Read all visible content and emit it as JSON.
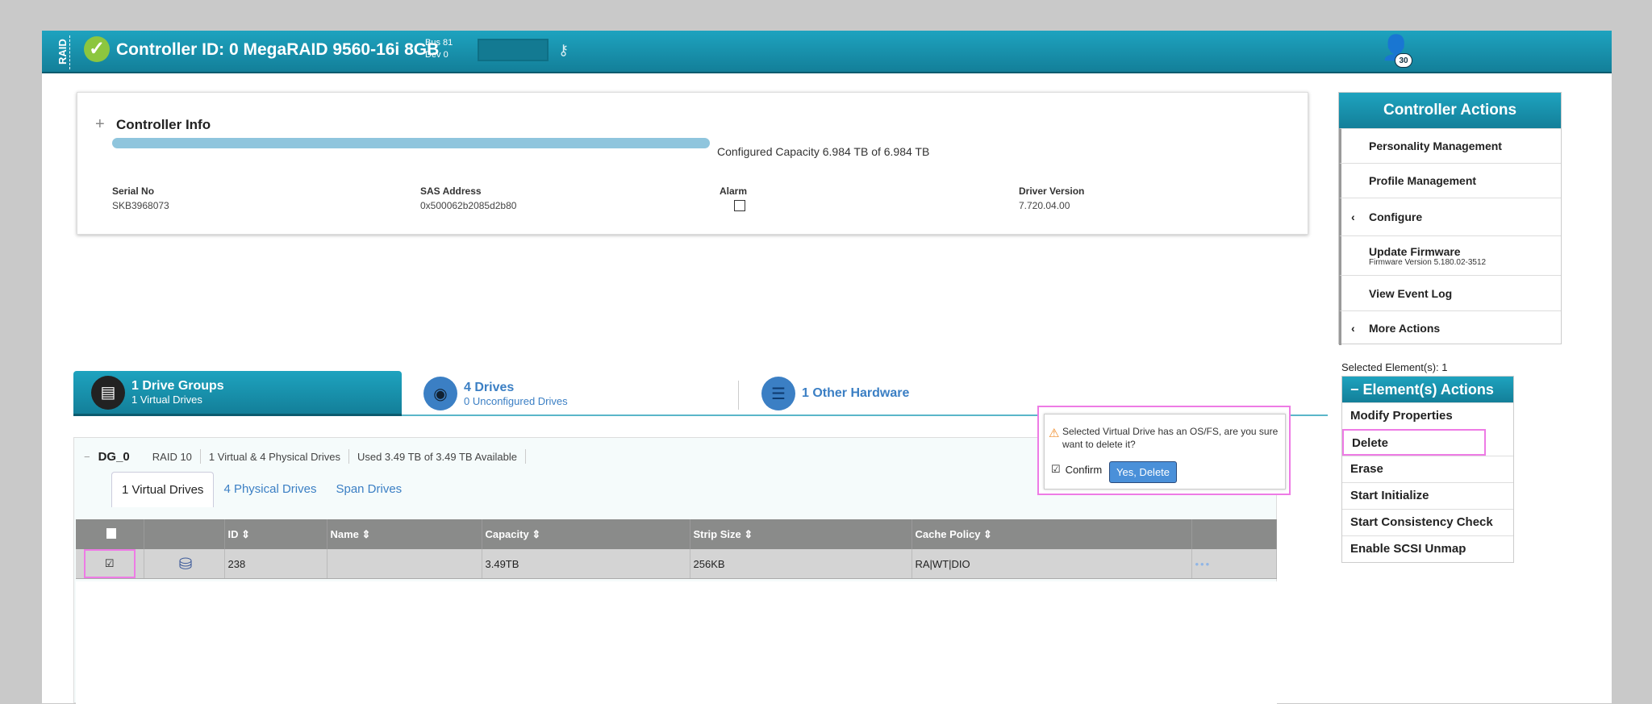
{
  "header": {
    "side_label": "RAID",
    "title": "Controller ID: 0 MegaRAID 9560-16i 8GB",
    "bus": "Bus 81",
    "dev": "Dev 0",
    "user_badge": "30"
  },
  "controller_info": {
    "title": "Controller Info",
    "configured_capacity": "Configured Capacity 6.984 TB of 6.984 TB",
    "capacity_fraction": 1.0,
    "fields": [
      {
        "label": "Serial No",
        "value": "SKB3968073"
      },
      {
        "label": "SAS Address",
        "value": "0x500062b2085d2b80"
      },
      {
        "label": "Alarm",
        "checked": false
      },
      {
        "label": "Driver Version",
        "value": "7.720.04.00"
      }
    ]
  },
  "controller_actions": {
    "title": "Controller Actions",
    "items": [
      {
        "label": "Personality Management"
      },
      {
        "label": "Profile Management"
      },
      {
        "label": "Configure"
      },
      {
        "label": "Update Firmware",
        "sub": "Firmware Version 5.180.02-3512"
      },
      {
        "label": "View Event Log"
      },
      {
        "label": "More Actions"
      }
    ]
  },
  "selected_elements": "Selected Element(s): 1",
  "element_actions": {
    "title": "Element(s) Actions",
    "items": [
      "Modify Properties",
      "Delete",
      "Erase",
      "Start Initialize",
      "Start Consistency Check",
      "Enable SCSI Unmap"
    ]
  },
  "tabs": [
    {
      "title": "1 Drive Groups",
      "sub": "1 Virtual Drives"
    },
    {
      "title": "4 Drives",
      "sub": "0 Unconfigured Drives"
    },
    {
      "title": "1 Other Hardware"
    }
  ],
  "drive_group": {
    "name": "DG_0",
    "raid": "RAID 10",
    "drives": "1 Virtual & 4 Physical Drives",
    "usage": "Used 3.49 TB of 3.49 TB Available",
    "subtabs": [
      "1 Virtual Drives",
      "4 Physical Drives",
      "Span Drives"
    ],
    "columns": [
      "ID",
      "Name",
      "Capacity",
      "Strip Size",
      "Cache Policy"
    ],
    "rows": [
      {
        "checked": true,
        "id": "238",
        "name": "",
        "capacity": "3.49TB",
        "strip": "256KB",
        "cache": "RA|WT|DIO"
      }
    ]
  },
  "popup": {
    "message": "Selected Virtual Drive has an OS/FS, are you sure want to delete it?",
    "confirm_label": "Confirm",
    "confirm_checked": true,
    "button": "Yes, Delete"
  },
  "colors": {
    "header": "#1794b0",
    "highlight": "#ee7be5",
    "link": "#3b7fc4"
  }
}
